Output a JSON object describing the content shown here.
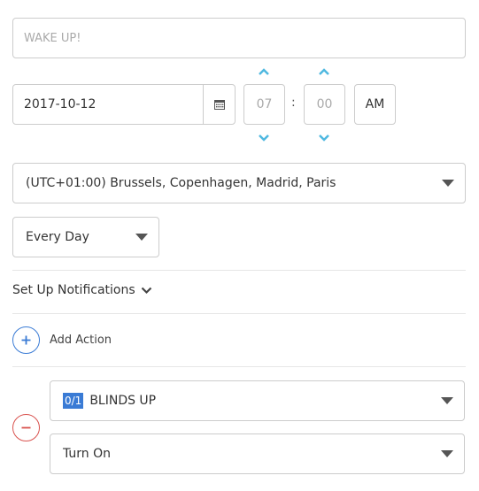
{
  "title_input": {
    "placeholder": "WAKE UP!"
  },
  "date": {
    "value": "2017-10-12",
    "icon": "calendar-icon"
  },
  "time": {
    "hour": "07",
    "separator": ":",
    "minute": "00",
    "period": "AM"
  },
  "timezone": {
    "selected": "(UTC+01:00) Brussels, Copenhagen, Madrid, Paris"
  },
  "frequency": {
    "selected": "Every Day"
  },
  "notifications": {
    "label": "Set Up Notifications"
  },
  "add_action": {
    "label": "Add Action"
  },
  "action": {
    "device_tag": "0/1",
    "device": "BLINDS UP",
    "command": "Turn On"
  },
  "colors": {
    "accent": "#3a7bd5",
    "danger": "#d9534f",
    "chevron": "#4fb8e0"
  }
}
